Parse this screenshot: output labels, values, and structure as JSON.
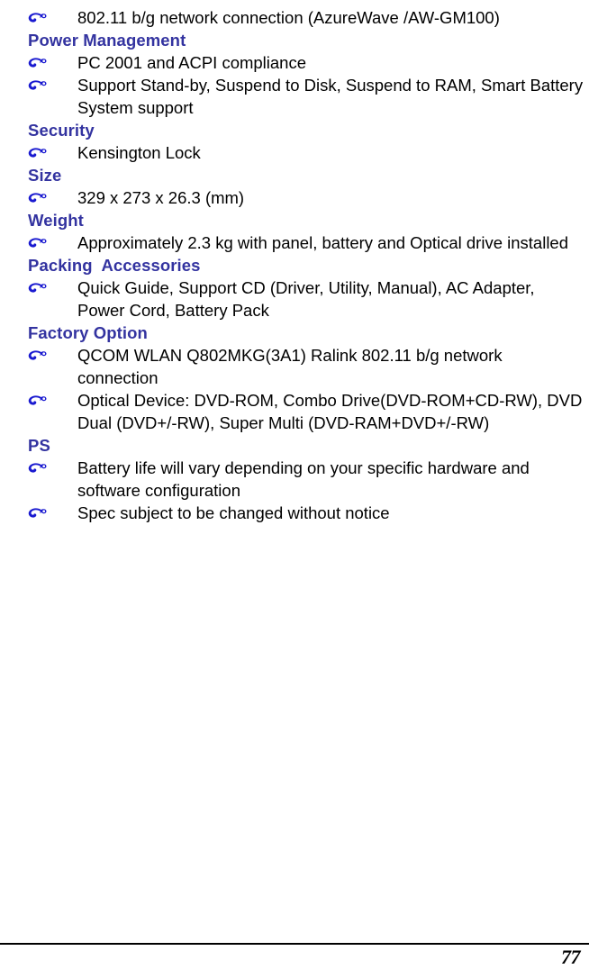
{
  "document": {
    "page_number": "77",
    "bullet_icon": "curly-loop-fleuron-bullet",
    "colors": {
      "heading": "#3333a0",
      "bullet": "#1a1ad0",
      "body_text": "#000000",
      "background": "#ffffff",
      "footer_rule": "#000000"
    }
  },
  "blocks": [
    {
      "type": "bullet",
      "text": "802.11 b/g network connection (AzureWave /AW-GM100)"
    },
    {
      "type": "heading",
      "text": "Power Management"
    },
    {
      "type": "bullet",
      "text": "PC 2001 and ACPI compliance"
    },
    {
      "type": "bullet",
      "text": "Support Stand-by, Suspend to Disk, Suspend to RAM, Smart Battery System support"
    },
    {
      "type": "heading",
      "text": "Security"
    },
    {
      "type": "bullet",
      "text": "Kensington Lock"
    },
    {
      "type": "heading",
      "text": "Size"
    },
    {
      "type": "bullet",
      "text": "329 x 273 x 26.3 (mm)"
    },
    {
      "type": "heading",
      "text": "Weight"
    },
    {
      "type": "bullet",
      "text": "Approximately 2.3 kg with panel, battery and Optical drive installed"
    },
    {
      "type": "heading",
      "text": "Packing  Accessories"
    },
    {
      "type": "bullet",
      "text": "Quick Guide, Support CD (Driver, Utility, Manual), AC Adapter, Power Cord, Battery Pack"
    },
    {
      "type": "heading",
      "text": "Factory Option"
    },
    {
      "type": "bullet",
      "text": "QCOM WLAN Q802MKG(3A1) Ralink 802.11 b/g network connection"
    },
    {
      "type": "bullet",
      "text": "Optical Device: DVD-ROM, Combo Drive(DVD-ROM+CD-RW), DVD Dual (DVD+/-RW), Super Multi (DVD-RAM+DVD+/-RW)"
    },
    {
      "type": "heading",
      "text": "PS"
    },
    {
      "type": "bullet",
      "text": "Battery life will vary depending on your specific hardware and software configuration"
    },
    {
      "type": "bullet",
      "text": "Spec subject to be changed without notice"
    }
  ]
}
